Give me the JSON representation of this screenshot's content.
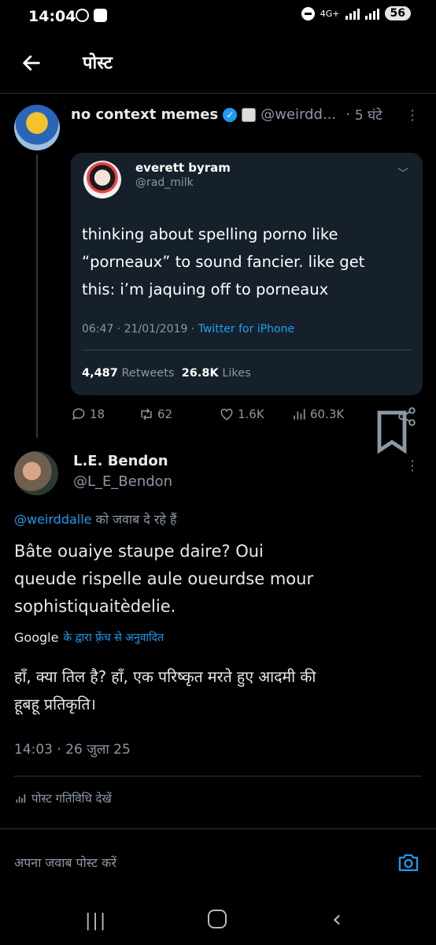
{
  "status_bar": {
    "time": "14:04",
    "network": "4G+",
    "battery": "56"
  },
  "header": {
    "title": "पोस्ट"
  },
  "post": {
    "author_name": "no context memes",
    "handle": "@weirdd...",
    "time": "5 घंटे",
    "quoted": {
      "name": "everett byram",
      "handle": "@rad_milk",
      "text_line1": "thinking about spelling porno like",
      "text_line2": "“porneaux” to sound fancier. like get",
      "text_line3": "this: i’m jaquing off to porneaux",
      "meta_time": "06:47 · 21/01/2019 · ",
      "meta_source": "Twitter for iPhone",
      "retweets_count": "4,487",
      "retweets_label": "Retweets",
      "likes_count": "26.8K",
      "likes_label": "Likes"
    },
    "actions": {
      "replies": "18",
      "reposts": "62",
      "likes": "1.6K",
      "views": "60.3K"
    }
  },
  "reply": {
    "author_name": "L.E. Bendon",
    "handle": "@L_E_Bendon",
    "replying_mention": "@weirddalle",
    "replying_suffix": " को जवाब दे रहे हैं",
    "text_line1": "Bâte ouaiye staupe daire? Oui",
    "text_line2": "queude rispelle aule oueurdse mour",
    "text_line3": "sophistiquaitèdelie.",
    "translated_brand": "Google",
    "translated_by": "के द्वारा फ़्रेंच से अनुवादित",
    "translation_line1": "हाँ, क्या तिल है? हाँ, एक परिष्कृत मरते हुए आदमी की",
    "translation_line2": "हूबहू प्रतिकृति।",
    "timestamp": "14:03 · 26 जुला 25",
    "activity_label": "पोस्ट गतिविधि देखें"
  },
  "compose": {
    "placeholder": "अपना जवाब पोस्ट करें"
  },
  "colors": {
    "background": "#000000",
    "accent": "#1d9bf0",
    "muted": "#8b98a5",
    "card": "#15202b"
  }
}
